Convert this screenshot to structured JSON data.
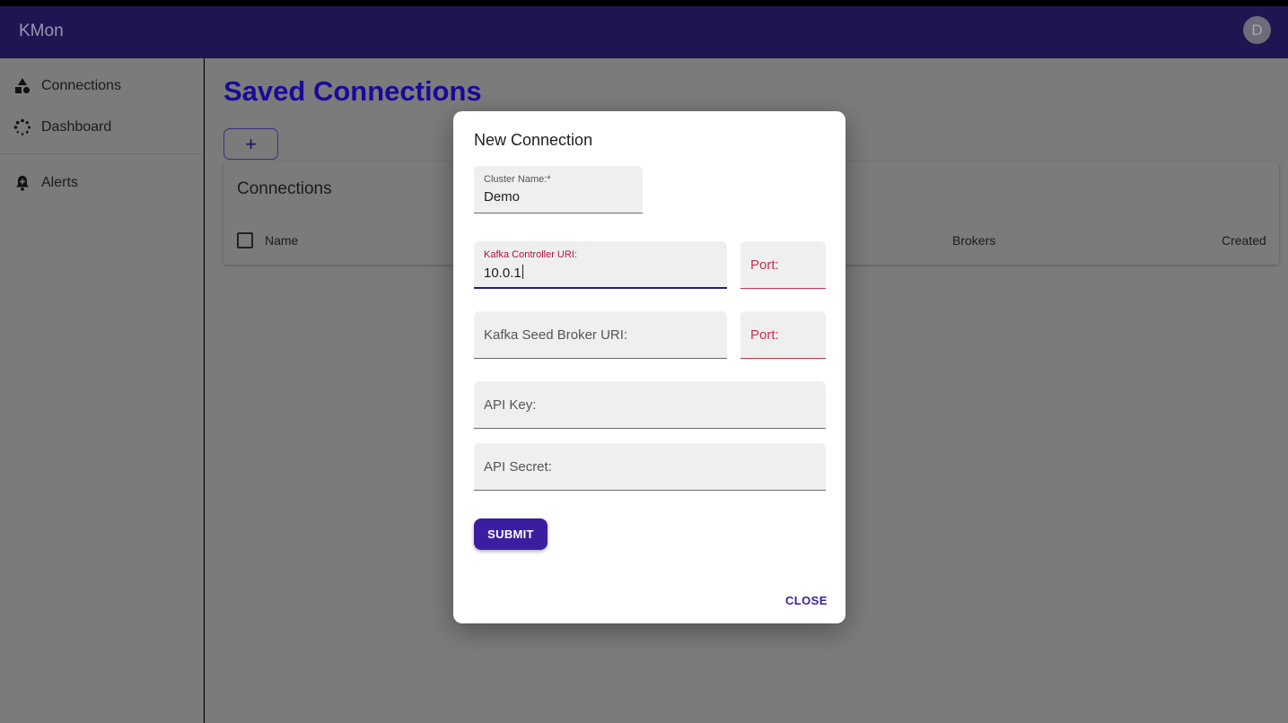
{
  "app": {
    "title": "KMon",
    "avatar_initial": "D"
  },
  "sidebar": {
    "items": [
      {
        "label": "Connections",
        "icon": "shapes-icon"
      },
      {
        "label": "Dashboard",
        "icon": "loading-dots-icon"
      },
      {
        "label": "Alerts",
        "icon": "bell-add-icon"
      }
    ]
  },
  "main": {
    "page_title": "Saved Connections",
    "add_button": "+",
    "panel_title": "Connections",
    "columns": [
      "Name",
      "Brokers",
      "Created"
    ]
  },
  "modal": {
    "title": "New Connection",
    "fields": {
      "cluster_name": {
        "label": "Cluster Name:*",
        "value": "Demo"
      },
      "controller_uri": {
        "label": "Kafka Controller URI:",
        "value": "10.0.1"
      },
      "controller_port": {
        "placeholder": "Port:"
      },
      "seed_broker_uri": {
        "placeholder": "Kafka Seed Broker URI:"
      },
      "seed_broker_port": {
        "placeholder": "Port:"
      },
      "api_key": {
        "placeholder": "API Key:"
      },
      "api_secret": {
        "placeholder": "API Secret:"
      }
    },
    "submit_label": "SUBMIT",
    "close_label": "CLOSE"
  },
  "colors": {
    "appbar": "#1e1551",
    "accent": "#3b1ea0",
    "title_blue": "#1a0a9a",
    "error_red": "#c8304f",
    "overlay": "#7b7b7b"
  }
}
